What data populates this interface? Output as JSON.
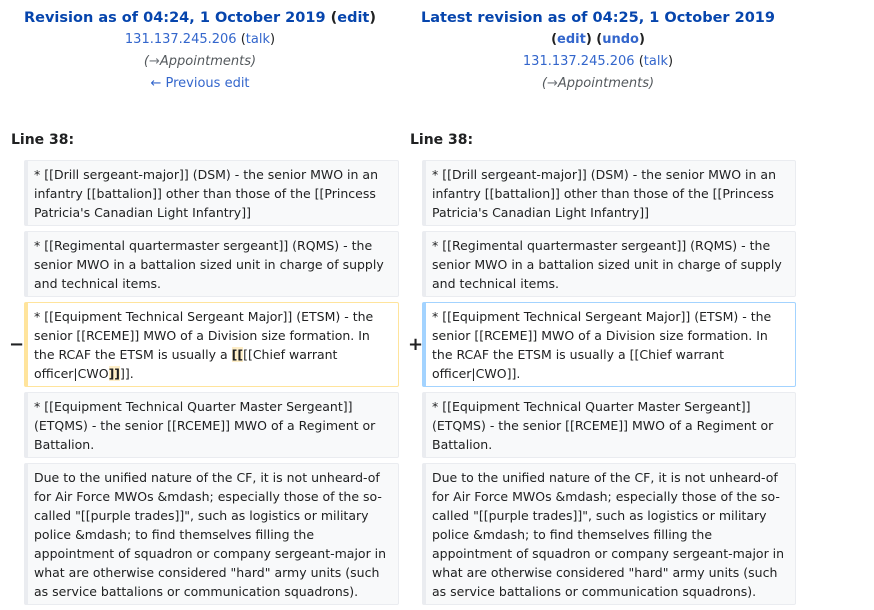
{
  "left_header": {
    "title": "Revision as of 04:24, 1 October 2019",
    "edit_label": "edit",
    "user": "131.137.245.206",
    "talk_label": "talk",
    "summary_arrow": "→",
    "summary_section": "Appointments",
    "prev_edit": "← Previous edit"
  },
  "right_header": {
    "title": "Latest revision as of 04:25, 1 October 2019",
    "edit_label": "edit",
    "undo_label": "undo",
    "user": "131.137.245.206",
    "talk_label": "talk",
    "summary_arrow": "→",
    "summary_section": "Appointments"
  },
  "line_label": "Line 38:",
  "rows": [
    {
      "left": "* [[Drill sergeant-major]] (DSM) - the senior MWO in an infantry [[battalion]] other than those of the [[Princess Patricia's Canadian Light Infantry]]",
      "right": "* [[Drill sergeant-major]] (DSM) - the senior MWO in an infantry [[battalion]] other than those of the [[Princess Patricia's Canadian Light Infantry]]"
    },
    {
      "left": "* [[Regimental quartermaster sergeant]] (RQMS) - the senior MWO in a battalion sized unit in charge of supply and technical items.",
      "right": "* [[Regimental quartermaster sergeant]] (RQMS) - the senior MWO in a battalion sized unit in charge of supply and technical items."
    },
    {
      "left_before": "* [[Equipment Technical Sergeant Major]] (ETSM) - the senior [[RCEME]] MWO of a Division size formation. In the RCAF the ETSM is usually a ",
      "left_del1": "[[",
      "left_mid": "[[Chief warrant officer|CWO",
      "left_del2": "]]",
      "left_after": "]].",
      "right": "* [[Equipment Technical Sergeant Major]] (ETSM) - the senior [[RCEME]] MWO of a Division size formation. In the RCAF the ETSM is usually a [[Chief warrant officer|CWO]].",
      "minus": "−",
      "plus": "+"
    },
    {
      "left": "* [[Equipment Technical Quarter Master Sergeant]] (ETQMS) - the senior [[RCEME]] MWO of a Regiment or Battalion.",
      "right": "* [[Equipment Technical Quarter Master Sergeant]] (ETQMS) - the senior [[RCEME]] MWO of a Regiment or Battalion."
    },
    {
      "left": "Due to the unified nature of the CF, it is not unheard-of for Air Force MWOs &mdash; especially those of the so-called \"[[purple trades]]\", such as logistics or military police &mdash; to find themselves filling the appointment of squadron or company sergeant-major in what are otherwise considered \"hard\" army units (such as service battalions or communication squadrons).",
      "right": "Due to the unified nature of the CF, it is not unheard-of for Air Force MWOs &mdash; especially those of the so-called \"[[purple trades]]\", such as logistics or military police &mdash; to find themselves filling the appointment of squadron or company sergeant-major in what are otherwise considered \"hard\" army units (such as service battalions or communication squadrons)."
    }
  ]
}
